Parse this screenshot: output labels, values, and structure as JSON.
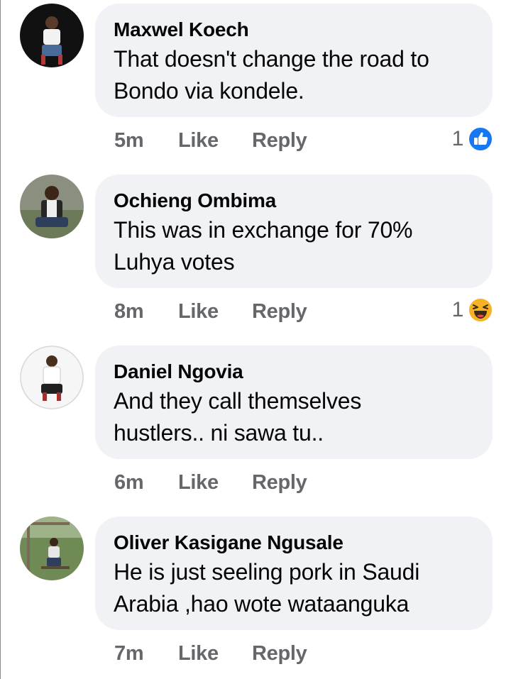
{
  "comments": [
    {
      "author": "Maxwel Koech",
      "text_lines": [
        "That doesn't change the road to",
        "Bondo via kondele."
      ],
      "time": "5m",
      "like_label": "Like",
      "reply_label": "Reply",
      "reaction_count": "1",
      "reaction_icon": "like-thumbs-up-icon"
    },
    {
      "author": "Ochieng Ombima",
      "text_lines": [
        "This was in exchange for 70%",
        "Luhya votes"
      ],
      "time": "8m",
      "like_label": "Like",
      "reply_label": "Reply",
      "reaction_count": "1",
      "reaction_icon": "haha-laughing-icon"
    },
    {
      "author": "Daniel Ngovia",
      "text_lines": [
        "And they call themselves",
        "hustlers.. ni sawa tu.."
      ],
      "time": "6m",
      "like_label": "Like",
      "reply_label": "Reply"
    },
    {
      "author": "Oliver Kasigane Ngusale",
      "text_lines": [
        "He is just seeling pork in Saudi",
        "Arabia ,hao wote wataanguka"
      ],
      "time": "7m",
      "like_label": "Like",
      "reply_label": "Reply"
    }
  ],
  "colors": {
    "bubble_bg": "#f0f2f5",
    "action_text": "#65676b",
    "like_blue": "#1877f2",
    "haha_yellow": "#f7b125"
  }
}
